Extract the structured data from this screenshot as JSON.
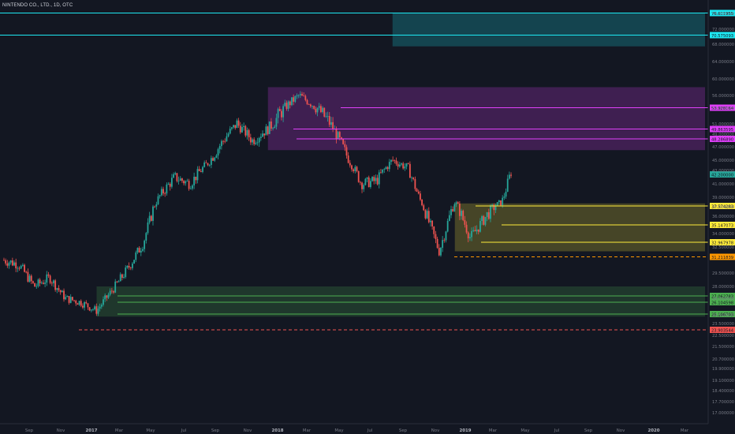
{
  "header": {
    "symbol_title": "NINTENDO CO., LTD., 1D, OTC"
  },
  "colors": {
    "background": "#131722",
    "candle_up": "#26a69a",
    "candle_down": "#ef5350",
    "axis_text": "#787b86",
    "cyan": "#1de9f3",
    "magenta": "#e040fb",
    "yellow": "#ffeb3b",
    "green": "#4caf50",
    "orange": "#ff9800",
    "red": "#ef5350"
  },
  "chart_data": {
    "type": "candlestick",
    "x_labels": [
      "Sep",
      "Nov",
      "2017",
      "Mar",
      "May",
      "Jul",
      "Sep",
      "Nov",
      "2018",
      "Mar",
      "May",
      "Jul",
      "Sep",
      "Nov",
      "2019",
      "Mar",
      "May",
      "Jul",
      "Sep",
      "Nov",
      "2020",
      "Mar"
    ],
    "y_ticks": [
      "76.000000",
      "72.000000",
      "68.000000",
      "64.000000",
      "60.000000",
      "56.000000",
      "53.000000",
      "51.000000",
      "49.000000",
      "47.000000",
      "45.000000",
      "43.000000",
      "41.000000",
      "39.000000",
      "37.000000",
      "36.000000",
      "34.000000",
      "32.500000",
      "29.500000",
      "28.000000",
      "26.500000",
      "24.500000",
      "23.500000",
      "22.500000",
      "21.500000",
      "20.700000",
      "19.900000",
      "19.100000",
      "18.400000",
      "17.700000",
      "17.000000"
    ],
    "price_path": [
      {
        "t": "2016-08",
        "p": 31.0
      },
      {
        "t": "2016-09",
        "p": 30.5
      },
      {
        "t": "2016-10",
        "p": 28.0
      },
      {
        "t": "2016-11",
        "p": 29.0
      },
      {
        "t": "2016-12",
        "p": 26.5
      },
      {
        "t": "2017-01",
        "p": 26.0
      },
      {
        "t": "2017-02",
        "p": 25.0
      },
      {
        "t": "2017-03",
        "p": 27.5
      },
      {
        "t": "2017-04",
        "p": 30.0
      },
      {
        "t": "2017-05",
        "p": 33.0
      },
      {
        "t": "2017-06",
        "p": 39.0
      },
      {
        "t": "2017-07",
        "p": 42.0
      },
      {
        "t": "2017-08",
        "p": 41.0
      },
      {
        "t": "2017-09",
        "p": 44.0
      },
      {
        "t": "2017-10",
        "p": 47.5
      },
      {
        "t": "2017-11",
        "p": 51.0
      },
      {
        "t": "2017-12",
        "p": 48.0
      },
      {
        "t": "2018-01",
        "p": 50.0
      },
      {
        "t": "2018-02",
        "p": 53.0
      },
      {
        "t": "2018-03",
        "p": 56.0
      },
      {
        "t": "2018-04",
        "p": 53.5
      },
      {
        "t": "2018-05",
        "p": 51.0
      },
      {
        "t": "2018-06",
        "p": 46.0
      },
      {
        "t": "2018-07",
        "p": 41.0
      },
      {
        "t": "2018-08",
        "p": 41.5
      },
      {
        "t": "2018-09",
        "p": 45.0
      },
      {
        "t": "2018-10",
        "p": 43.5
      },
      {
        "t": "2018-11",
        "p": 37.0
      },
      {
        "t": "2018-12",
        "p": 32.0
      },
      {
        "t": "2019-01",
        "p": 38.0
      },
      {
        "t": "2019-02",
        "p": 33.5
      },
      {
        "t": "2019-03",
        "p": 36.0
      },
      {
        "t": "2019-04",
        "p": 38.0
      },
      {
        "t": "2019-04-20",
        "p": 43.0
      }
    ],
    "zones": [
      {
        "name": "cyan-zone",
        "color": "#1de9f3",
        "low": 67.5,
        "high": 77.0,
        "from": "2018-09",
        "to": "2020-04"
      },
      {
        "name": "magenta-zone",
        "color": "#e040fb",
        "low": 46.5,
        "high": 58.0,
        "from": "2018-01",
        "to": "2020-04"
      },
      {
        "name": "yellow-zone",
        "color": "#ffeb3b",
        "low": 32.0,
        "high": 37.7,
        "from": "2019-01",
        "to": "2020-04"
      },
      {
        "name": "green-zone",
        "color": "#4caf50",
        "low": 24.3,
        "high": 28.0,
        "from": "2017-02",
        "to": "2020-04"
      }
    ],
    "levels": [
      {
        "color": "#1de9f3",
        "label": "76.611955",
        "style": "solid"
      },
      {
        "color": "#1de9f3",
        "label": "70.575093",
        "style": "solid"
      },
      {
        "color": "#e040fb",
        "label": "53.928164",
        "style": "solid"
      },
      {
        "color": "#e040fb",
        "label": "49.863595",
        "style": "solid"
      },
      {
        "color": "#e040fb",
        "label": "48.286890",
        "style": "solid"
      },
      {
        "color": "#26a69a",
        "label": "42.200000",
        "style": "marker"
      },
      {
        "color": "#ffeb3b",
        "label": "37.574283",
        "style": "solid"
      },
      {
        "color": "#ffeb3b",
        "label": "35.147073",
        "style": "solid"
      },
      {
        "color": "#ffeb3b",
        "label": "32.967978",
        "style": "solid"
      },
      {
        "color": "#ff9800",
        "label": "31.211839",
        "style": "dashed"
      },
      {
        "color": "#4caf50",
        "label": "27.062783",
        "style": "solid"
      },
      {
        "color": "#4caf50",
        "label": "26.104598",
        "style": "solid"
      },
      {
        "color": "#4caf50",
        "label": "25.106703",
        "style": "solid"
      },
      {
        "color": "#ef5350",
        "label": "23.903544",
        "style": "dashed"
      }
    ]
  }
}
